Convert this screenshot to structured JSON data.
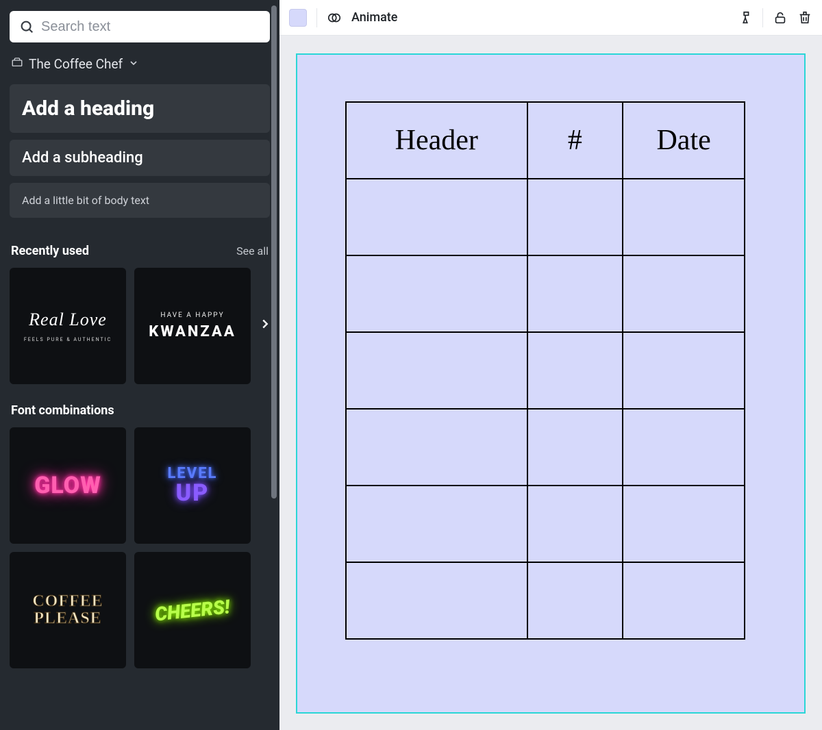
{
  "sidebar": {
    "search_placeholder": "Search text",
    "brandkit_label": "The Coffee Chef",
    "add_heading": "Add a heading",
    "add_subheading": "Add a subheading",
    "add_body": "Add a little bit of body text",
    "recently_used_title": "Recently used",
    "see_all": "See all",
    "font_combinations_title": "Font combinations",
    "recent_tiles": [
      {
        "id": "real-love",
        "line1": "Real Love",
        "line2": "FEELS PURE & AUTHENTIC"
      },
      {
        "id": "kwanzaa",
        "line1": "HAVE A HAPPY",
        "line2": "KWANZAA"
      }
    ],
    "font_tiles": [
      {
        "id": "glow",
        "line1": "GLOW"
      },
      {
        "id": "levelup",
        "line1": "LEVEL",
        "line2": "UP"
      },
      {
        "id": "coffee",
        "line1": "COFFEE",
        "line2": "PLEASE"
      },
      {
        "id": "cheers",
        "line1": "CHEERS!"
      }
    ]
  },
  "toolbar": {
    "swatch_color": "#d6d9fb",
    "animate_label": "Animate"
  },
  "canvas": {
    "bg": "#d6d9fb",
    "selection_color": "#2ad6d6",
    "table": {
      "headers": [
        "Header",
        "#",
        "Date"
      ],
      "body_rows": 6
    }
  }
}
